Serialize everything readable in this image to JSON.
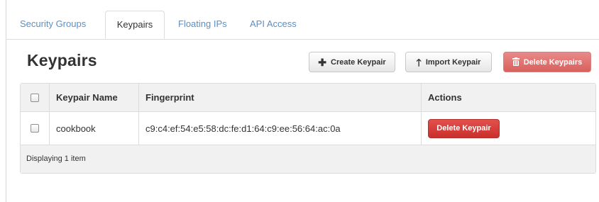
{
  "tabs": [
    {
      "label": "Security Groups",
      "active": false
    },
    {
      "label": "Keypairs",
      "active": true
    },
    {
      "label": "Floating IPs",
      "active": false
    },
    {
      "label": "API Access",
      "active": false
    }
  ],
  "page_title": "Keypairs",
  "toolbar": {
    "create_label": "Create Keypair",
    "create_icon": "plus-icon",
    "import_label": "Import Keypair",
    "import_icon": "arrow-up-icon",
    "delete_label": "Delete Keypairs",
    "delete_icon": "trash-icon"
  },
  "table": {
    "columns": [
      "Keypair Name",
      "Fingerprint",
      "Actions"
    ],
    "rows": [
      {
        "name": "cookbook",
        "fingerprint": "c9:c4:ef:54:e5:58:dc:fe:d1:64:c9:ee:56:64:ac:0a",
        "action_label": "Delete Keypair"
      }
    ],
    "footer": "Displaying 1 item"
  },
  "colors": {
    "link": "#5b8fc7",
    "danger": "#d9534f",
    "danger_disabled": "#e07b78"
  }
}
